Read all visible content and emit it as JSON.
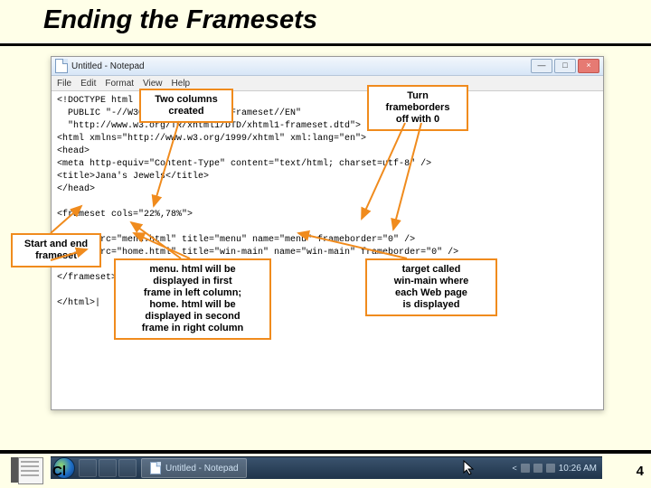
{
  "slide": {
    "title": "Ending the Framesets",
    "chapter_label": "Cl",
    "page_number": "4"
  },
  "window": {
    "title": "Untitled - Notepad",
    "btn_min": "—",
    "btn_max": "□",
    "btn_close": "×",
    "menu": [
      "File",
      "Edit",
      "Format",
      "View",
      "Help"
    ]
  },
  "code": "<!DOCTYPE html\n  PUBLIC \"-//W3C//DTD XHTML 1.0 Frameset//EN\"\n  \"http://www.w3.org/TR/xhtml1/DTD/xhtml1-frameset.dtd\">\n<html xmlns=\"http://www.w3.org/1999/xhtml\" xml:lang=\"en\">\n<head>\n<meta http-equiv=\"Content-Type\" content=\"text/html; charset=utf-8\" />\n<title>Jana's Jewels</title>\n</head>\n\n<frameset cols=\"22%,78%\">\n\n<frame src=\"menu.html\" title=\"menu\" name=\"menu\" frameborder=\"0\" />\n<frame src=\"home.html\" title=\"win-main\" name=\"win-main\" frameborder=\"0\" />\n\n</frameset>\n\n</html>|",
  "callouts": {
    "two_cols": "Two columns\ncreated",
    "frameborders": "Turn\nframeborders\noff with 0",
    "start_end": "Start and end\nframeset",
    "menu_home": "menu. html will be\ndisplayed in first\nframe in left column;\nhome. html will be\ndisplayed in second\nframe in right column",
    "target": "target called\nwin-main where\neach Web page\nis displayed"
  },
  "taskbar": {
    "item": "Untitled - Notepad",
    "time": "10:26 AM"
  }
}
